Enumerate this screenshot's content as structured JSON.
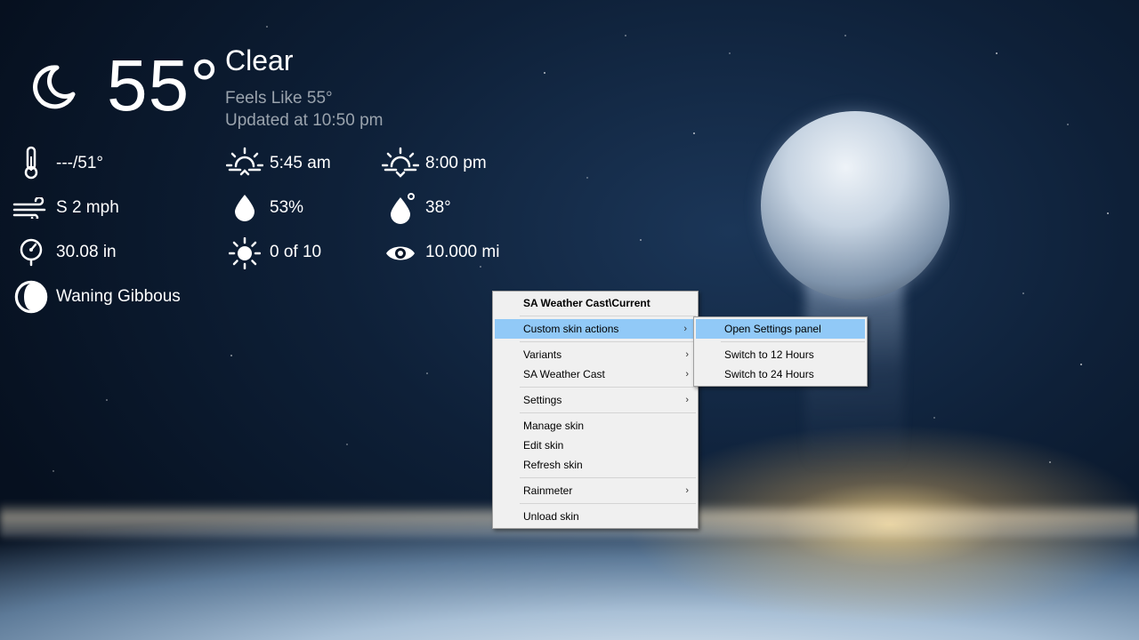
{
  "weather": {
    "temperature": "55°",
    "condition": "Clear",
    "feels_like": "Feels Like 55°",
    "updated": "Updated at 10:50 pm",
    "stats": {
      "temp_range": "---/51°",
      "sunrise": "5:45 am",
      "sunset": "8:00 pm",
      "wind": "S 2 mph",
      "humidity": "53%",
      "dew_point": "38°",
      "pressure": "30.08 in",
      "uv_index": "0 of 10",
      "visibility": "10.000 mi",
      "moon_phase": "Waning Gibbous"
    },
    "icons": {
      "condition": "moon-crescent-icon",
      "temp_range": "thermometer-icon",
      "sunrise": "sunrise-icon",
      "sunset": "sunset-icon",
      "wind": "wind-icon",
      "humidity": "droplet-icon",
      "dew_point": "dew-point-icon",
      "pressure": "barometer-icon",
      "uv_index": "sun-icon",
      "visibility": "eye-icon",
      "moon_phase": "moon-phase-icon"
    }
  },
  "context_menu": {
    "header": "SA Weather Cast\\Current",
    "items": {
      "custom_skin_actions": "Custom skin actions",
      "variants": "Variants",
      "sa_weather_cast": "SA Weather Cast",
      "settings": "Settings",
      "manage_skin": "Manage skin",
      "edit_skin": "Edit skin",
      "refresh_skin": "Refresh skin",
      "rainmeter": "Rainmeter",
      "unload_skin": "Unload skin"
    },
    "submenu_arrow": "›"
  },
  "submenu": {
    "open_settings_panel": "Open Settings panel",
    "switch_12": "Switch to 12 Hours",
    "switch_24": "Switch to 24 Hours"
  },
  "colors": {
    "highlight": "#91c9f7",
    "menu_bg": "#f0f0f0",
    "secondary_text": "#9aa3ad"
  }
}
